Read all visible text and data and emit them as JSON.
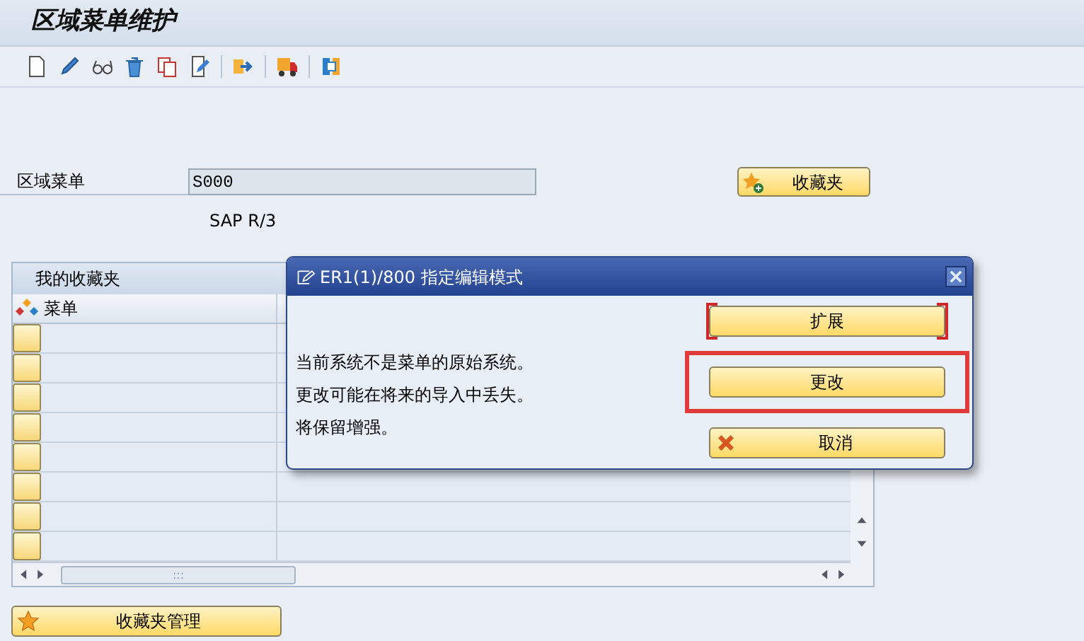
{
  "title": "区域菜单维护",
  "form": {
    "label": "区域菜单",
    "value": "S000",
    "note": "SAP R/3",
    "favorites_button": "收藏夹"
  },
  "favorites_panel": {
    "title": "我的收藏夹",
    "column": "菜单",
    "scroll_grip": ":::"
  },
  "manage_button": "收藏夹管理",
  "dialog": {
    "title": "ER1(1)/800 指定编辑模式",
    "message": [
      "当前系统不是菜单的原始系统。",
      "更改可能在将来的导入中丢失。",
      "将保留增强。"
    ],
    "buttons": [
      {
        "label": "扩展",
        "kind": "plain",
        "focused": true,
        "highlighted": false
      },
      {
        "label": "更改",
        "kind": "plain",
        "focused": false,
        "highlighted": true
      },
      {
        "label": "取消",
        "kind": "cancel",
        "focused": false,
        "highlighted": false
      }
    ]
  }
}
